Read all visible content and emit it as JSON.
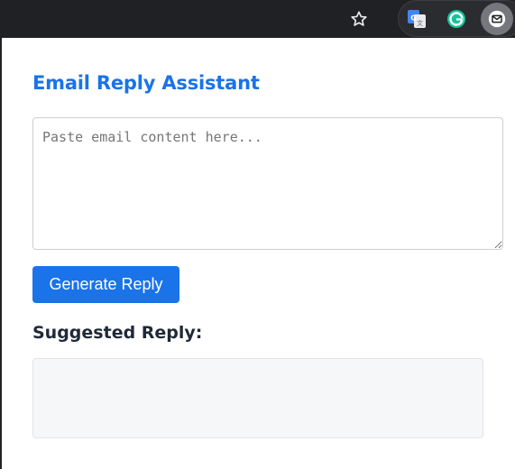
{
  "browser": {
    "icons": {
      "bookmark": "star-icon",
      "translate": "google-translate-icon",
      "grammarly": "grammarly-icon",
      "mail": "mail-icon"
    },
    "colors": {
      "toolbar_bg": "#202124",
      "icon": "#e8eaed"
    }
  },
  "popup": {
    "title": "Email Reply Assistant",
    "email_input": {
      "placeholder": "Paste email content here...",
      "value": ""
    },
    "generate_button_label": "Generate Reply",
    "suggested_reply_label": "Suggested Reply:",
    "suggested_reply_text": "",
    "colors": {
      "accent": "#1a73e8",
      "heading": "#1f2937",
      "reply_box_bg": "#f6f7f8"
    }
  }
}
